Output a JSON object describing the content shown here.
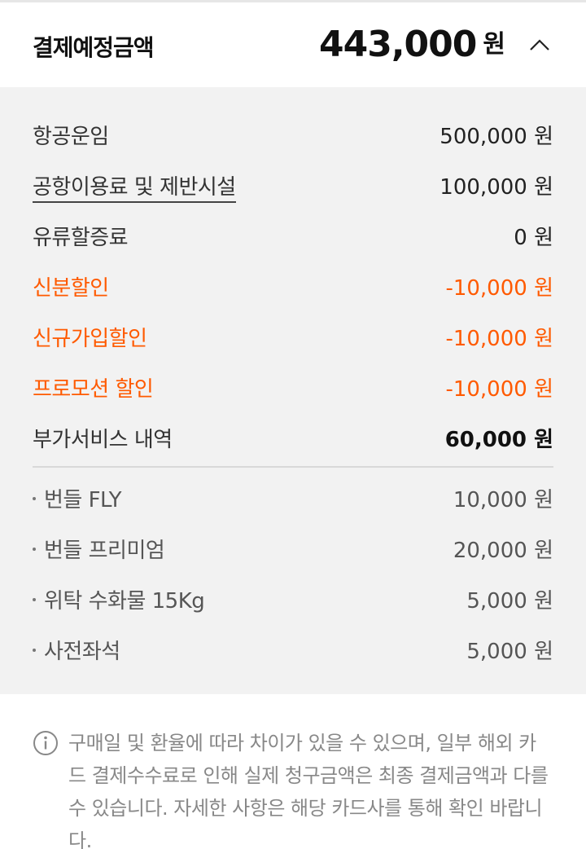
{
  "header": {
    "title": "결제예정금액",
    "amount": "443,000",
    "unit": "원",
    "collapse_icon": "chevron-up-icon"
  },
  "breakdown": [
    {
      "label": "항공운임",
      "value": "500,000 원"
    },
    {
      "label": "공항이용료 및 제반시설",
      "value": "100,000 원"
    },
    {
      "label": "유류할증료",
      "value": "0 원"
    },
    {
      "label": "신분할인",
      "value": "-10,000 원"
    },
    {
      "label": "신규가입할인",
      "value": "-10,000 원"
    },
    {
      "label": "프로모션 할인",
      "value": "-10,000 원"
    },
    {
      "label": "부가서비스 내역",
      "value": "60,000 원"
    }
  ],
  "addons": [
    {
      "label": "번들 FLY",
      "value": "10,000 원"
    },
    {
      "label": "번들 프리미엄",
      "value": "20,000 원"
    },
    {
      "label": "위탁 수화물 15Kg",
      "value": "5,000 원"
    },
    {
      "label": "사전좌석",
      "value": "5,000 원"
    }
  ],
  "colors": {
    "discount": "#ff5a00",
    "panel_bg": "#f2f2f2"
  },
  "notice": {
    "icon": "info-icon",
    "text": "구매일 및 환율에 따라 차이가 있을 수 있으며, 일부 해외 카드 결제수수료로 인해 실제 청구금액은 최종 결제금액과 다를 수 있습니다. 자세한 사항은 해당 카드사를 통해 확인 바랍니다."
  }
}
